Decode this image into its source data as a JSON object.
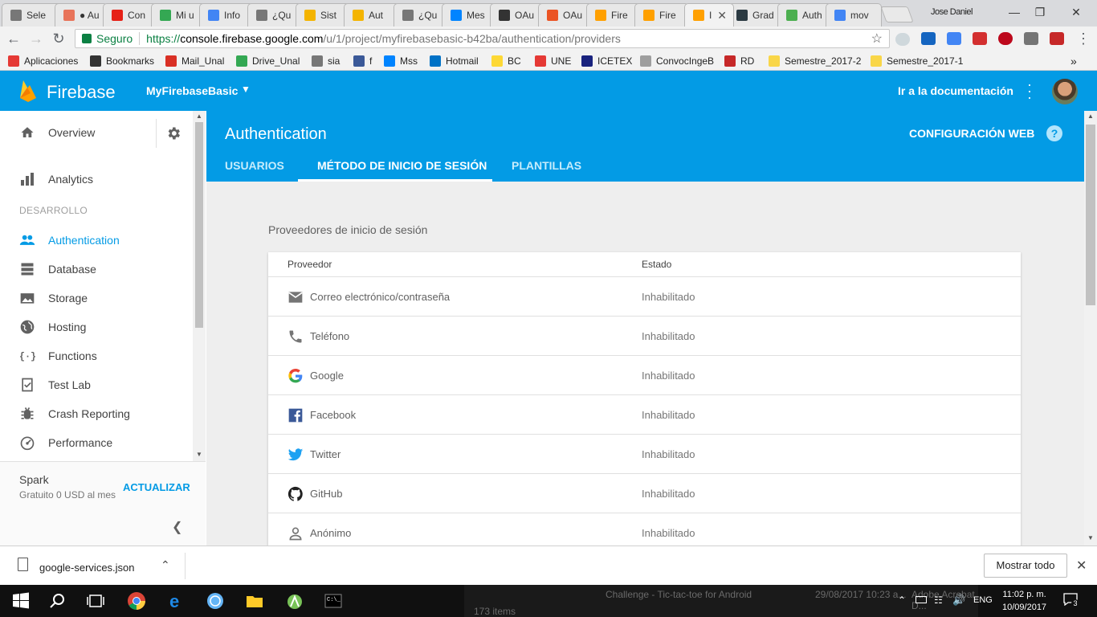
{
  "browser": {
    "tabs": [
      {
        "label": "Sele",
        "icon": "document-icon",
        "color": "#777777"
      },
      {
        "label": "● Au",
        "icon": "app-icon",
        "color": "#e8745a"
      },
      {
        "label": "Con",
        "icon": "youtube-icon",
        "color": "#e62117"
      },
      {
        "label": "Mi u",
        "icon": "drive-icon",
        "color": "#34a853"
      },
      {
        "label": "Info",
        "icon": "docs-icon",
        "color": "#4285f4"
      },
      {
        "label": "¿Qu",
        "icon": "document-icon",
        "color": "#777777"
      },
      {
        "label": "Sist",
        "icon": "slides-icon",
        "color": "#f4b400"
      },
      {
        "label": "Aut",
        "icon": "slides-icon",
        "color": "#f4b400"
      },
      {
        "label": "¿Qu",
        "icon": "document-icon",
        "color": "#777777"
      },
      {
        "label": "Mes",
        "icon": "messenger-icon",
        "color": "#0084ff"
      },
      {
        "label": "OAu",
        "icon": "pk-icon",
        "color": "#333333"
      },
      {
        "label": "OAu",
        "icon": "badge-icon",
        "color": "#eb5424"
      },
      {
        "label": "Fire",
        "icon": "firebase-icon",
        "color": "#ffa000"
      },
      {
        "label": "Fire",
        "icon": "firebase-icon",
        "color": "#ffa000"
      },
      {
        "label": "I",
        "icon": "firebase-icon",
        "color": "#ffa000"
      },
      {
        "label": "Grad",
        "icon": "elephant-icon",
        "color": "#2b3a42"
      },
      {
        "label": "Auth",
        "icon": "code-icon",
        "color": "#4caf50"
      },
      {
        "label": "mov",
        "icon": "window-icon",
        "color": "#4285f4"
      }
    ],
    "user": "Jose Daniel",
    "address": {
      "secure_label": "Seguro",
      "protocol": "https://",
      "host": "console.firebase.google.com",
      "path": "/u/1/project/myfirebasebasic-b42ba/authentication/providers"
    },
    "bookmarks": [
      {
        "label": "Aplicaciones",
        "icon": "apps-grid-icon",
        "color": "#e53935"
      },
      {
        "label": "Bookmarks",
        "icon": "star-icon",
        "color": "#333333"
      },
      {
        "label": "Mail_Unal",
        "icon": "gmail-icon",
        "color": "#d93025"
      },
      {
        "label": "Drive_Unal",
        "icon": "drive-icon",
        "color": "#34a853"
      },
      {
        "label": "sia",
        "icon": "document-icon",
        "color": "#777777"
      },
      {
        "label": "f",
        "icon": "facebook-icon",
        "color": "#3b5998"
      },
      {
        "label": "Mss",
        "icon": "messenger-icon",
        "color": "#0084ff"
      },
      {
        "label": "Hotmail",
        "icon": "outlook-icon",
        "color": "#0072c6"
      },
      {
        "label": "BC",
        "icon": "bank-icon",
        "color": "#fdd835"
      },
      {
        "label": "UNE",
        "icon": "une-icon",
        "color": "#e53935"
      },
      {
        "label": "ICETEX",
        "icon": "icetex-icon",
        "color": "#1a237e"
      },
      {
        "label": "ConvocIngeB",
        "icon": "seal-icon",
        "color": "#9e9e9e"
      },
      {
        "label": "RD",
        "icon": "rd-icon",
        "color": "#c62828"
      },
      {
        "label": "Semestre_2017-2",
        "icon": "folder-icon",
        "color": "#f9d648"
      },
      {
        "label": "Semestre_2017-1",
        "icon": "folder-icon",
        "color": "#f9d648"
      }
    ]
  },
  "firebase": {
    "brand": "Firebase",
    "project": "MyFirebaseBasic",
    "docs_link": "Ir a la documentación",
    "sidebar": {
      "overview": "Overview",
      "section_label": "DESARROLLO",
      "analytics": "Analytics",
      "items": [
        {
          "label": "Authentication",
          "icon": "people-icon",
          "active": true
        },
        {
          "label": "Database",
          "icon": "database-icon",
          "active": false
        },
        {
          "label": "Storage",
          "icon": "image-icon",
          "active": false
        },
        {
          "label": "Hosting",
          "icon": "globe-icon",
          "active": false
        },
        {
          "label": "Functions",
          "icon": "functions-icon",
          "active": false
        },
        {
          "label": "Test Lab",
          "icon": "checklist-icon",
          "active": false
        },
        {
          "label": "Crash Reporting",
          "icon": "bug-icon",
          "active": false
        },
        {
          "label": "Performance",
          "icon": "gauge-icon",
          "active": false
        }
      ],
      "plan_name": "Spark",
      "plan_price": "Gratuito 0 USD al mes",
      "upgrade": "ACTUALIZAR"
    },
    "main": {
      "title": "Authentication",
      "web_config": "CONFIGURACIÓN WEB",
      "help": "?",
      "tabs": [
        {
          "label": "USUARIOS",
          "active": false
        },
        {
          "label": "MÉTODO DE INICIO DE SESIÓN",
          "active": true
        },
        {
          "label": "PLANTILLAS",
          "active": false
        }
      ],
      "providers_title": "Proveedores de inicio de sesión",
      "columns": {
        "provider": "Proveedor",
        "state": "Estado"
      },
      "providers": [
        {
          "name": "Correo electrónico/contraseña",
          "state": "Inhabilitado",
          "icon": "email-icon"
        },
        {
          "name": "Teléfono",
          "state": "Inhabilitado",
          "icon": "phone-icon"
        },
        {
          "name": "Google",
          "state": "Inhabilitado",
          "icon": "google-icon"
        },
        {
          "name": "Facebook",
          "state": "Inhabilitado",
          "icon": "facebook-icon"
        },
        {
          "name": "Twitter",
          "state": "Inhabilitado",
          "icon": "twitter-icon"
        },
        {
          "name": "GitHub",
          "state": "Inhabilitado",
          "icon": "github-icon"
        },
        {
          "name": "Anónimo",
          "state": "Inhabilitado",
          "icon": "person-icon"
        }
      ]
    }
  },
  "downloads": {
    "file": "google-services.json",
    "show_all": "Mostrar todo"
  },
  "taskbar": {
    "ghost_title": "Challenge - Tic-tac-toe for Android",
    "ghost_date": "29/08/2017 10:23 a...",
    "ghost_app": "Adobe Acrobat D...",
    "ghost_items": "173 items",
    "language": "ENG",
    "time": "11:02 p. m.",
    "date": "10/09/2017",
    "notifications": "3"
  },
  "colors": {
    "firebase_blue": "#039be5",
    "active_nav": "#039be5",
    "secure_green": "#0b8043"
  }
}
